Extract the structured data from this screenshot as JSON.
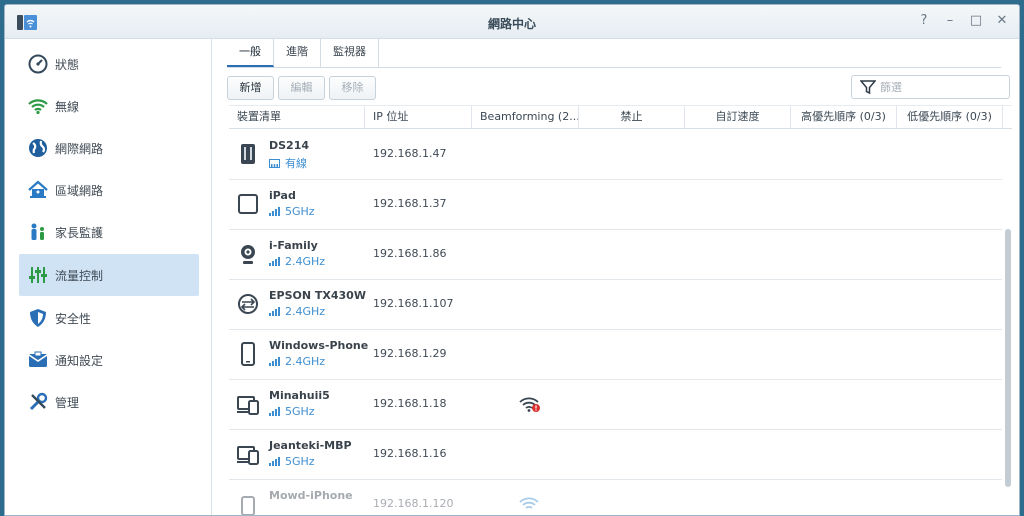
{
  "window": {
    "title": "網路中心",
    "accent": "#2a6fb5"
  },
  "window_controls": [
    "?",
    "–",
    "□",
    "✕"
  ],
  "sidebar": {
    "items": [
      {
        "label": "狀態",
        "icon": "status-gauge-icon"
      },
      {
        "label": "無線",
        "icon": "wifi-icon"
      },
      {
        "label": "網際網路",
        "icon": "globe-icon"
      },
      {
        "label": "區域網路",
        "icon": "home-network-icon"
      },
      {
        "label": "家長監護",
        "icon": "family-icon"
      },
      {
        "label": "流量控制",
        "icon": "traffic-sliders-icon",
        "active": true
      },
      {
        "label": "安全性",
        "icon": "shield-icon"
      },
      {
        "label": "通知設定",
        "icon": "notification-envelope-icon"
      },
      {
        "label": "管理",
        "icon": "tools-icon"
      }
    ]
  },
  "tabs": [
    {
      "label": "一般",
      "active": true
    },
    {
      "label": "進階"
    },
    {
      "label": "監視器"
    }
  ],
  "toolbar": {
    "add": "新增",
    "edit": "編輯",
    "remove": "移除"
  },
  "filter": {
    "placeholder": "篩選",
    "value": ""
  },
  "columns": [
    "裝置清單",
    "IP 位址",
    "Beamforming (2...",
    "禁止",
    "自訂速度",
    "高優先順序 (0/3)",
    "低優先順序 (0/3)"
  ],
  "devices": [
    {
      "name": "DS214",
      "conn": "有線",
      "conn_type": "wired",
      "ip": "192.168.1.47",
      "icon": "nas-icon",
      "beamforming": ""
    },
    {
      "name": "iPad",
      "conn": "5GHz",
      "conn_type": "wifi",
      "ip": "192.168.1.37",
      "icon": "tablet-icon",
      "beamforming": ""
    },
    {
      "name": "i-Family",
      "conn": "2.4GHz",
      "conn_type": "wifi",
      "ip": "192.168.1.86",
      "icon": "webcam-icon",
      "beamforming": ""
    },
    {
      "name": "EPSON TX430W",
      "conn": "2.4GHz",
      "conn_type": "wifi",
      "ip": "192.168.1.107",
      "icon": "network-device-icon",
      "beamforming": ""
    },
    {
      "name": "Windows-Phone",
      "conn": "2.4GHz",
      "conn_type": "wifi",
      "ip": "192.168.1.29",
      "icon": "phone-icon",
      "beamforming": ""
    },
    {
      "name": "Minahuii5",
      "conn": "5GHz",
      "conn_type": "wifi",
      "ip": "192.168.1.18",
      "icon": "multi-device-icon",
      "beamforming": "alert"
    },
    {
      "name": "Jeanteki-MBP",
      "conn": "5GHz",
      "conn_type": "wifi",
      "ip": "192.168.1.16",
      "icon": "multi-device-icon",
      "beamforming": ""
    },
    {
      "name": "Mowd-iPhone",
      "conn": "",
      "conn_type": "wifi",
      "ip": "192.168.1.120",
      "icon": "phone-icon",
      "beamforming": "wifi"
    }
  ]
}
